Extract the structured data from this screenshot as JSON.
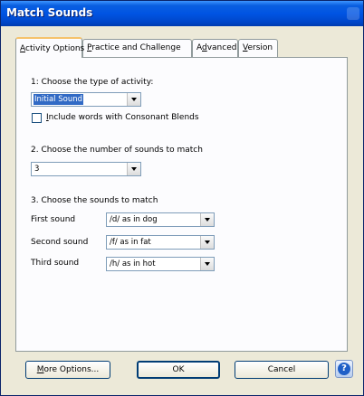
{
  "window": {
    "title": "Match Sounds"
  },
  "tabs": [
    {
      "key": "A",
      "rest": "ctivity Options"
    },
    {
      "key": "P",
      "rest": "ractice and Challenge"
    },
    {
      "pre": "A",
      "key": "d",
      "rest": "vanced"
    },
    {
      "key": "V",
      "rest": "ersion"
    }
  ],
  "activity": {
    "section1_label": "1: Choose the type of activity:",
    "type_value": "Initial Sound",
    "blends_key": "I",
    "blends_rest": "nclude words with Consonant Blends",
    "blends_checked": false,
    "section2_label": "2. Choose the number of sounds to match",
    "count_value": "3",
    "section3_label": "3. Choose the sounds to match",
    "sounds": [
      {
        "label": "First sound",
        "value": "/d/ as in dog"
      },
      {
        "label": "Second sound",
        "value": "/f/ as in fat"
      },
      {
        "label": "Third sound",
        "value": "/h/ as in hot"
      }
    ]
  },
  "buttons": {
    "more_key": "M",
    "more_rest": "ore Options...",
    "ok": "OK",
    "cancel": "Cancel",
    "help_icon": "help-question-icon"
  }
}
